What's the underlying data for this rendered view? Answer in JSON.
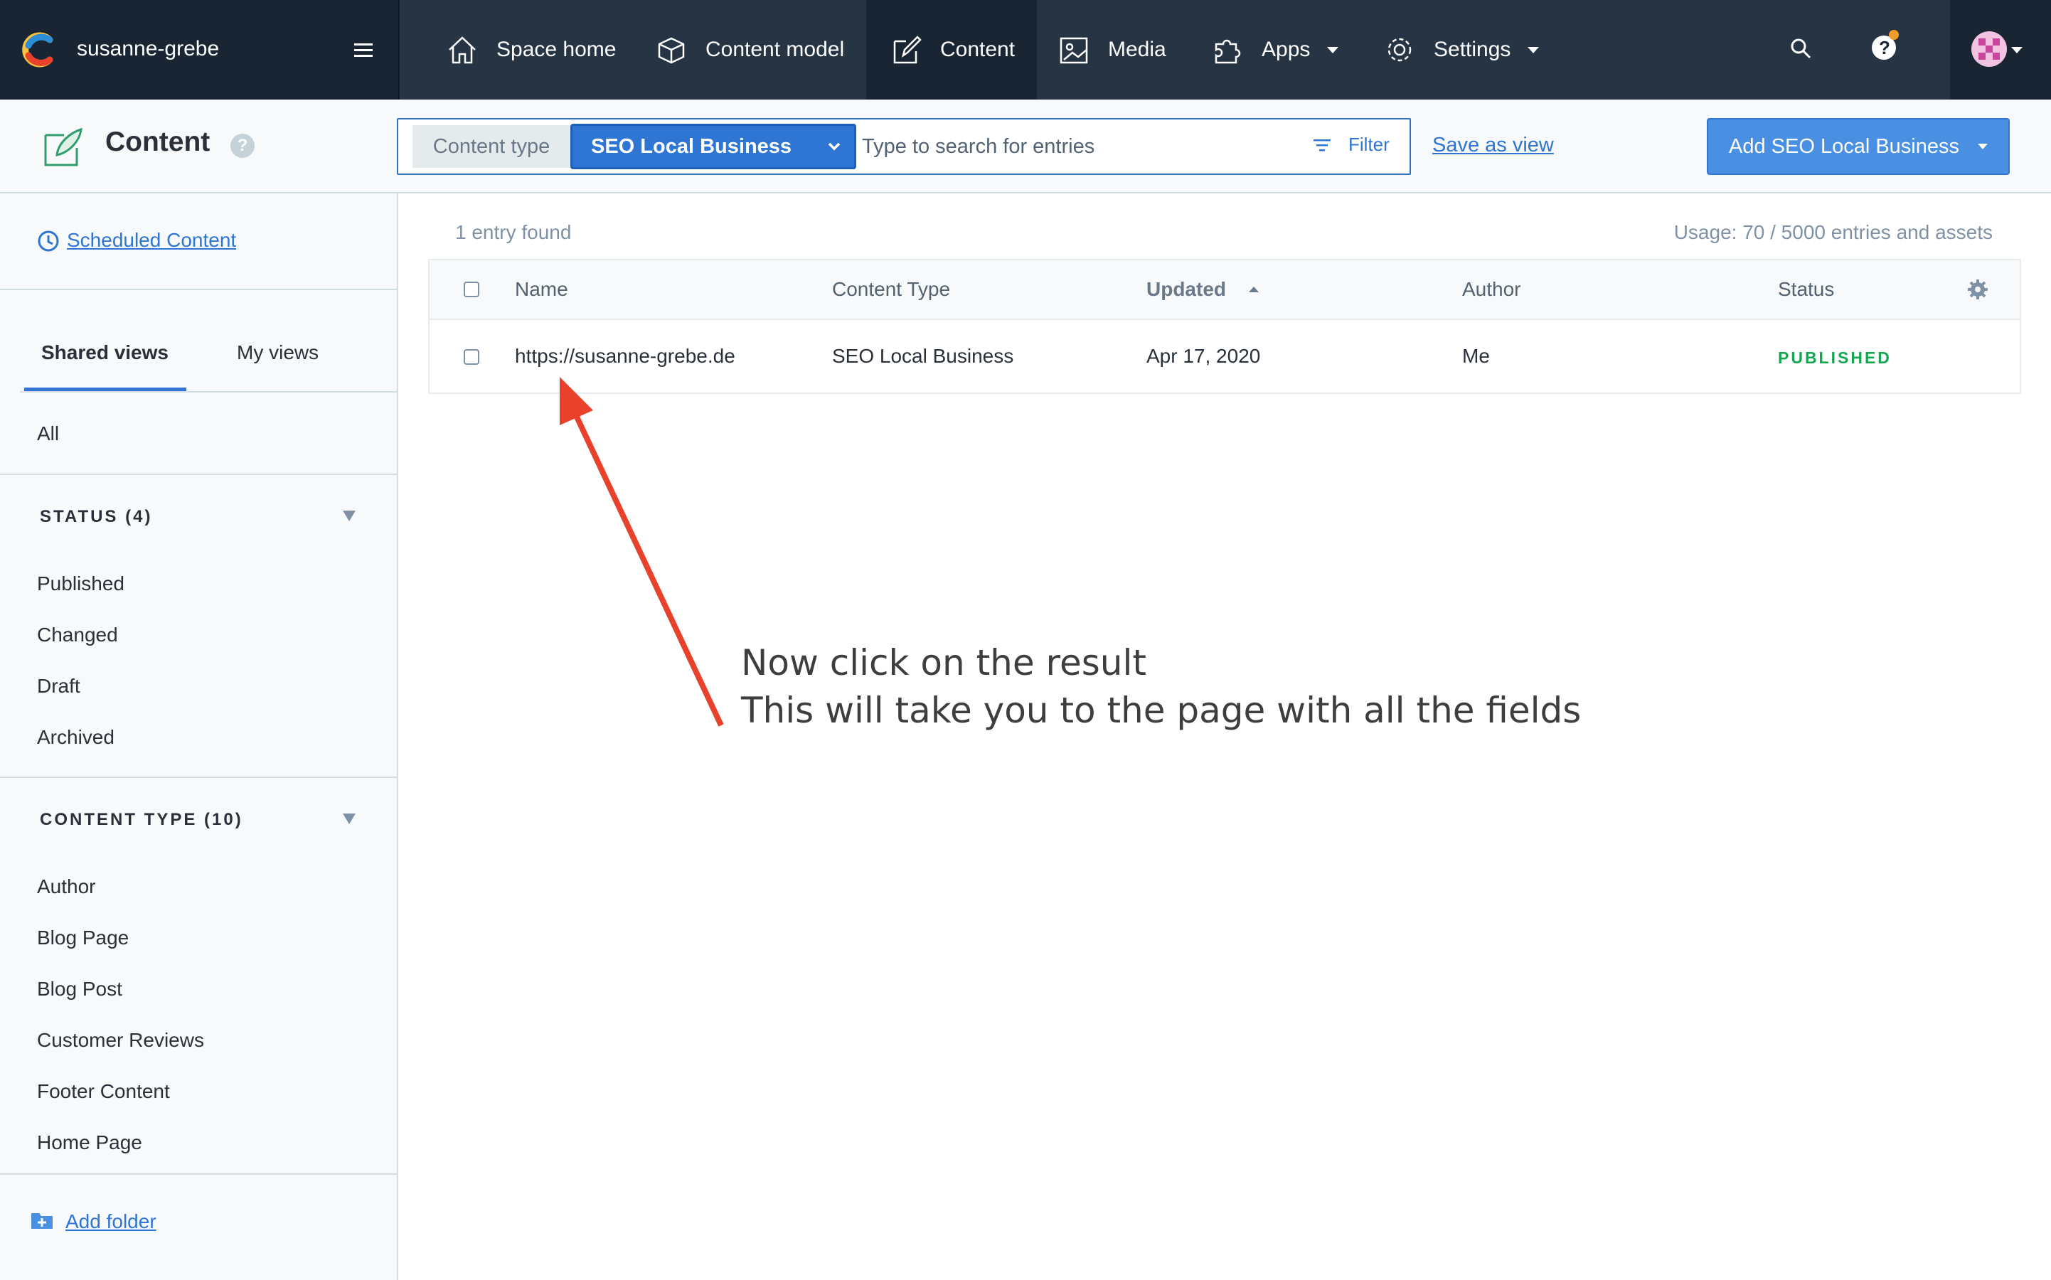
{
  "app": {
    "space_name": "susanne-grebe",
    "logo": "contentful-logo-icon"
  },
  "nav": {
    "items": [
      {
        "label": "Space home",
        "icon": "house-icon"
      },
      {
        "label": "Content model",
        "icon": "cube-icon"
      },
      {
        "label": "Content",
        "icon": "pencil-square-icon",
        "active": true
      },
      {
        "label": "Media",
        "icon": "image-icon"
      },
      {
        "label": "Apps",
        "icon": "puzzle-icon",
        "dropdown": true
      },
      {
        "label": "Settings",
        "icon": "gear-icon",
        "dropdown": true
      }
    ]
  },
  "header": {
    "title": "Content",
    "search": {
      "content_type_label": "Content type",
      "content_type_value": "SEO Local Business",
      "placeholder": "Type to search for entries",
      "filter_label": "Filter"
    },
    "save_view": "Save as view",
    "add_button": "Add SEO Local Business"
  },
  "sidebar": {
    "scheduled": "Scheduled Content",
    "tabs": [
      "Shared views",
      "My views"
    ],
    "all": "All",
    "status_heading": "STATUS (4)",
    "status_items": [
      "Published",
      "Changed",
      "Draft",
      "Archived"
    ],
    "ct_heading": "CONTENT TYPE (10)",
    "ct_items": [
      "Author",
      "Blog Page",
      "Blog Post",
      "Customer Reviews",
      "Footer Content",
      "Home Page"
    ],
    "add_folder": "Add folder"
  },
  "main": {
    "entry_count": "1 entry found",
    "usage": "Usage: 70 / 5000 entries and assets",
    "columns": [
      "Name",
      "Content Type",
      "Updated",
      "Author",
      "Status"
    ],
    "rows": [
      {
        "name": "https://susanne-grebe.de",
        "content_type": "SEO Local Business",
        "updated": "Apr 17, 2020",
        "author": "Me",
        "status": "PUBLISHED"
      }
    ]
  },
  "annotation": {
    "line1": "Now click on the result",
    "line2": "This will take you to the page with all the fields",
    "arrow_color": "#e8422c"
  },
  "colors": {
    "nav_bg": "#273444",
    "accent": "#2e75d4",
    "published": "#14a651"
  }
}
